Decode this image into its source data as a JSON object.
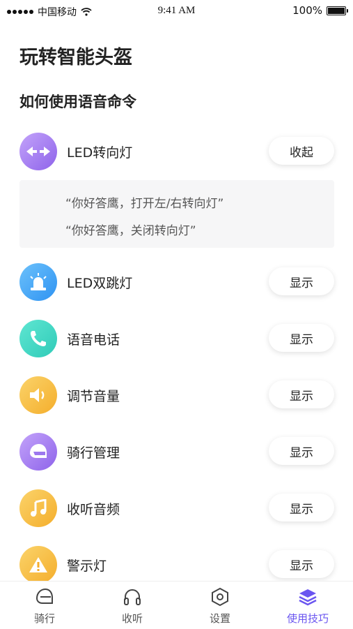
{
  "status_bar": {
    "carrier": "中国移动",
    "time": "9:41 AM",
    "battery": "100%"
  },
  "page_title": "玩转智能头盔",
  "section_title": "如何使用语音命令",
  "commands": [
    {
      "label": "LED转向灯",
      "button": "收起",
      "icon": "arrows-icon",
      "color": "#a57ff2"
    },
    {
      "label": "LED双跳灯",
      "button": "显示",
      "icon": "siren-icon",
      "color": "#3ea8f6"
    },
    {
      "label": "语音电话",
      "button": "显示",
      "icon": "phone-icon",
      "color": "#3ed8c2"
    },
    {
      "label": "调节音量",
      "button": "显示",
      "icon": "speaker-icon",
      "color": "#f7c043"
    },
    {
      "label": "骑行管理",
      "button": "显示",
      "icon": "helmet-icon",
      "color": "#a57ff2"
    },
    {
      "label": "收听音频",
      "button": "显示",
      "icon": "music-icon",
      "color": "#f7c043"
    },
    {
      "label": "警示灯",
      "button": "显示",
      "icon": "warning-icon",
      "color": "#f7c043"
    }
  ],
  "expanded": {
    "lines": [
      "“你好答鹰，打开左/右转向灯”",
      "“你好答鹰，关闭转向灯”"
    ]
  },
  "tabs": [
    {
      "label": "骑行",
      "icon": "helmet-icon",
      "active": false
    },
    {
      "label": "收听",
      "icon": "headphones-icon",
      "active": false
    },
    {
      "label": "设置",
      "icon": "hexagon-settings-icon",
      "active": false
    },
    {
      "label": "使用技巧",
      "icon": "layers-icon",
      "active": true
    }
  ],
  "colors": {
    "accent": "#6a55f0"
  }
}
